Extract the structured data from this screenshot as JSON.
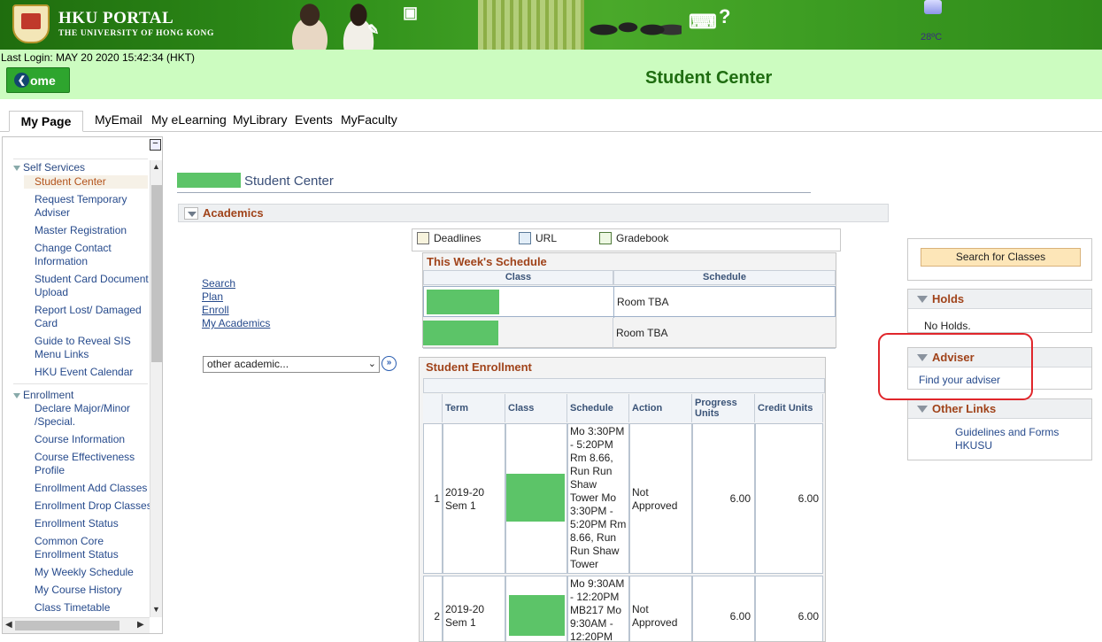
{
  "banner": {
    "title": "HKU PORTAL",
    "subtitle": "THE UNIVERSITY OF HONG KONG",
    "temperature": "28ºC"
  },
  "header": {
    "last_login": "Last Login: MAY 20 2020 15:42:34 (HKT)",
    "home_label": "ome",
    "page_title": "Student Center"
  },
  "tabs": [
    "My Page",
    "MyEmail",
    "My eLearning",
    "MyLibrary",
    "Events",
    "MyFaculty"
  ],
  "sidebar": {
    "groups": [
      {
        "label": "Self Services",
        "items": [
          "Student Center",
          "Request Temporary Adviser",
          "Master Registration",
          "Change Contact Information",
          "Student Card Document Upload",
          "Report Lost/ Damaged Card",
          "Guide to Reveal SIS Menu Links",
          "HKU Event Calendar"
        ]
      },
      {
        "label": "Enrollment",
        "items": [
          "Declare Major/Minor /Special.",
          "Course Information",
          "Course Effectiveness Profile",
          "Enrollment Add Classes",
          "Enrollment Drop Classes",
          "Enrollment Status",
          "Common Core Enrollment Status",
          "My Weekly Schedule",
          "My Course History",
          "Class Timetable"
        ]
      }
    ],
    "selected": "Student Center"
  },
  "main": {
    "title": "Student Center",
    "section": "Academics",
    "links": [
      "Search",
      "Plan",
      "Enroll",
      "My Academics"
    ],
    "other_academic_select": "other academic...",
    "toolbar": [
      "Deadlines",
      "URL",
      "Gradebook"
    ],
    "week_schedule": {
      "title": "This Week's Schedule",
      "columns": [
        "Class",
        "Schedule"
      ],
      "rows": [
        {
          "schedule": "Room  TBA"
        },
        {
          "schedule": "Room  TBA"
        }
      ]
    },
    "enrollment": {
      "title": "Student Enrollment",
      "columns": [
        "Term",
        "Class",
        "Schedule",
        "Action",
        "Progress Units",
        "Credit Units"
      ],
      "rows": [
        {
          "num": "1",
          "term": "2019-20 Sem 1",
          "schedule": "Mo 3:30PM - 5:20PM Rm 8.66, Run Run Shaw Tower Mo 3:30PM - 5:20PM Rm 8.66, Run Run Shaw Tower",
          "action": "Not Approved",
          "progress_units": "6.00",
          "credit_units": "6.00"
        },
        {
          "num": "2",
          "term": "2019-20 Sem 1",
          "schedule": "Mo 9:30AM - 12:20PM MB217 Mo 9:30AM - 12:20PM",
          "action": "Not Approved",
          "progress_units": "6.00",
          "credit_units": "6.00"
        }
      ]
    }
  },
  "right": {
    "search_button": "Search for Classes",
    "holds": {
      "title": "Holds",
      "text": "No Holds."
    },
    "adviser": {
      "title": "Adviser",
      "link": "Find your adviser"
    },
    "other_links": {
      "title": "Other Links",
      "links": [
        "Guidelines and Forms",
        "HKUSU"
      ]
    }
  },
  "colors": {
    "banner_green": "#2f8f1a",
    "header_band": "#ccfcc0",
    "title_green": "#1f6d11",
    "section_orange": "#a0431a",
    "link_blue": "#264a8c",
    "annotation_red": "#e0262b"
  }
}
